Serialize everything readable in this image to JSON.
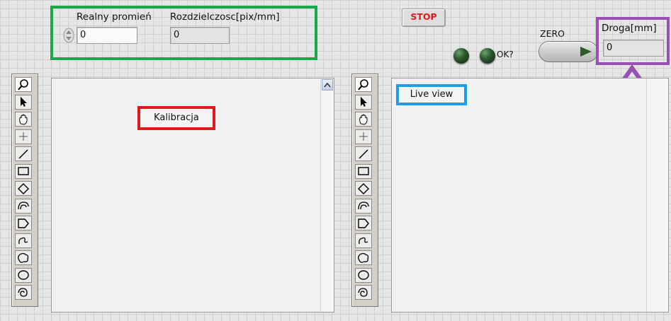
{
  "controls": {
    "radius_label": "Realny promień",
    "radius_value": "0",
    "resolution_label": "Rozdzielczosc[pix/mm]",
    "resolution_value": "0",
    "stop_label": "STOP",
    "ok_label": "OK?",
    "zero_label": "ZERO",
    "distance_label": "Droga[mm]",
    "distance_value": "0"
  },
  "panels": {
    "left": {
      "label": "Kalibracja"
    },
    "right": {
      "label": "Live view"
    }
  },
  "tools": [
    "zoom-icon",
    "pointer-icon",
    "pan-icon",
    "crosshair-icon",
    "line-icon",
    "rectangle-icon",
    "rotated-rect-icon",
    "annulus-icon",
    "polygon-icon",
    "freehand-line-icon",
    "freehand-region-icon",
    "oval-icon",
    "spiral-icon"
  ],
  "colors": {
    "highlight_green": "#1aa84a",
    "highlight_red": "#e01a1a",
    "highlight_blue": "#1aa0e8",
    "highlight_purple": "#9a4fb4",
    "stop_text": "#e01a1a",
    "led_green": "#2d5a2d"
  }
}
